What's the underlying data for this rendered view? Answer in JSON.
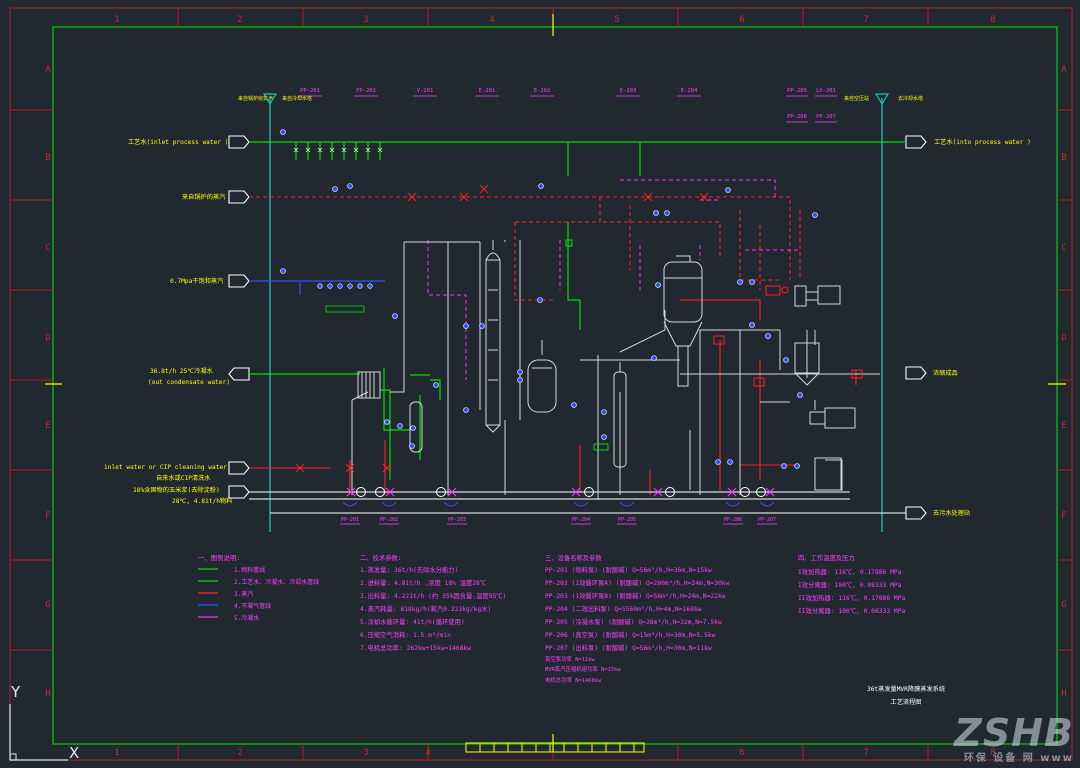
{
  "frame": {
    "col_labels": [
      "1",
      "2",
      "3",
      "4",
      "5",
      "6",
      "7",
      "8"
    ],
    "row_labels": [
      "A",
      "B",
      "C",
      "D",
      "E",
      "F",
      "G",
      "H"
    ]
  },
  "colors": {
    "background": "#212830",
    "process_water": "#00e000",
    "steam": "#ff2020",
    "condensate": "#ff30ff",
    "vacuum": "#3050ff",
    "equipment": "#d8d8d8",
    "labels": "#ffff00",
    "legend_magenta": "#ff40ff",
    "border": "#00e000",
    "outer_border": "#c02020"
  },
  "streams": {
    "inlet_process_water": "工艺水(inlet process water )",
    "outlet_process_water": "工艺水(into process water )",
    "steam_label": "来自锅炉的蒸汽",
    "vacuum_steam": "0.7Mpa干饱和蒸汽",
    "condensate_out": "36.8t/h  25℃冷凝水",
    "condensate_out_en": "(out condensate water)",
    "cip_in": "inlet water or CIP cleaning water",
    "cip_in_cn": "自来水或CIP清洗水",
    "feed_material": "18%含固物的玉米浆(去除淀粉)",
    "feed_conditions": "28℃, 4.81t/h物料",
    "product_out": "浓缩成品",
    "drain_out": "去污水处理站"
  },
  "legend": {
    "title": "一、图例说明:",
    "items": [
      "1.物料管线",
      "2.工艺水、冷凝水、冷却水管线",
      "3.蒸汽",
      "4.不凝气管线",
      "5.冷凝水"
    ]
  },
  "specs": {
    "title": "二、技术参数:",
    "lines": [
      "1.蒸发量: 36t/h(去除水分能力)",
      "2.进料量: 4.81t/h ,浓度 18% 温度28℃",
      "3.出料量: 4.221t/h (约 35%固含量,温度95℃)",
      "4.蒸汽耗量: 818kg/h(耗汽0.223kg/kg水)",
      "5.冷却水循环量: 41t/h(循环使用)",
      "6.压缩空气消耗: 1.5 m³/min",
      "7.电机总功率: 262kw+15kw=1468kw"
    ]
  },
  "pumps": {
    "title": "三、设备名称及参数",
    "lines": [
      "PP-201 (物料泵)  (耐酸碱) Q=56m³/h,H=36m,N=15kw",
      "PP-202 (1效循环泵A)  (耐酸碱) Q=280m³/h,H=24m,N=30kw",
      "PP-203 (1效循环泵B)  (耐酸碱) Q=56m³/h,H=24m,N=22kw",
      "PP-204 (二效出料泵)  Q=5560m³/h,H=4m,N=168kw",
      "PP-205 (冷凝水泵)  (耐酸碱) Q=26m³/h,H=32m,N=7.5kw",
      "PP-206 (真空泵)  (耐酸碱) Q=15m³/h,H=30m,N=5.5kw",
      "PP-207 (出料泵)  (耐酸碱) Q=56m³/h,H=30m,N=11kw",
      "真空泵功率 N=11kw",
      "MVR蒸汽压缩机组功率 N=15kw",
      "电机总功率 N=1468kw"
    ]
  },
  "operating": {
    "title": "四、工作温度及压力",
    "lines": [
      "I效加热器: 116℃, 0.17886 MPa",
      "I效分离器: 100℃, 0.08333 MPa",
      "II效加热器: 116℃, 0.17886 MPa",
      "II效分离器: 100℃, 0.08333 MPa"
    ]
  },
  "title_block": {
    "line1": "36t蒸发量MVR降膜蒸发系统",
    "line2": "工艺流程图"
  },
  "tags_top": [
    "PP-201",
    "PP-202",
    "V-201",
    "E-201",
    "E-202",
    "E-203",
    "E-204",
    "PP-205",
    "LX-201",
    "PP-206",
    "PP-207"
  ],
  "tags_bottom": [
    "PP-201",
    "PP-202",
    "PP-203",
    "PP-204",
    "PP-205",
    "PP-206",
    "PP-207"
  ],
  "top_notes": [
    "来自锅炉房蒸汽",
    "来自冷却水塔",
    "来自空压站",
    "去冷却水塔"
  ],
  "ucs": {
    "y": "Y",
    "x": "X"
  },
  "watermark": {
    "main": "ZSHB",
    "sub": "环保 设备 网 www"
  }
}
